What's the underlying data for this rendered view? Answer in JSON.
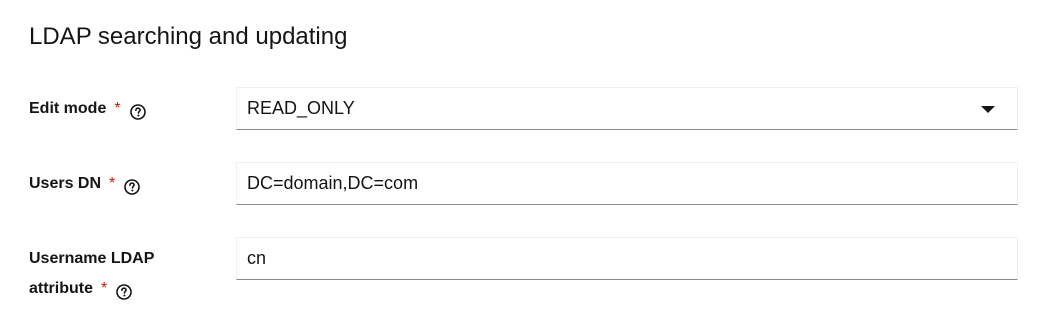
{
  "section": {
    "title": "LDAP searching and updating"
  },
  "fields": {
    "edit_mode": {
      "label": "Edit mode",
      "required_marker": "*",
      "help_icon": "help-circle-icon",
      "value": "READ_ONLY"
    },
    "users_dn": {
      "label": "Users DN",
      "required_marker": "*",
      "help_icon": "help-circle-icon",
      "value": "DC=domain,DC=com"
    },
    "username_attr": {
      "label_line1": "Username LDAP",
      "label_line2": "attribute",
      "required_marker": "*",
      "help_icon": "help-circle-icon",
      "value": "cn"
    }
  },
  "colors": {
    "required": "#c9190b",
    "text": "#151515",
    "input_border_bottom": "#8a8d90"
  }
}
